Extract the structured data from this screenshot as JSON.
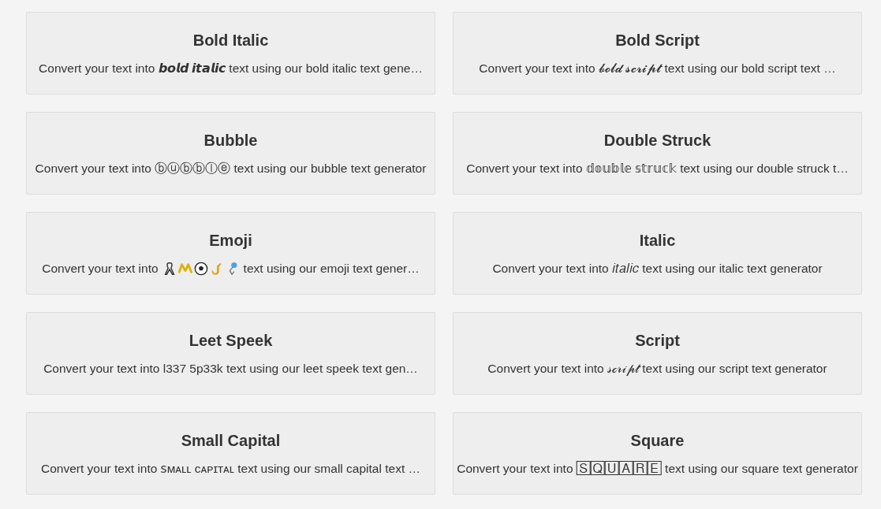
{
  "cards": [
    {
      "title": "Bold Italic",
      "kind": "text",
      "description": "Convert your text into 𝙗𝙤𝙡𝙙 𝙞𝙩𝙖𝙡𝙞𝙘 text using our bold italic text gene…"
    },
    {
      "title": "Bold Script",
      "kind": "text",
      "description": "Convert your text into 𝓫𝓸𝓵𝓭 𝓼𝓬𝓻𝓲𝓹𝓽 text using our bold script text …"
    },
    {
      "title": "Bubble",
      "kind": "text",
      "description": "Convert your text into ⓑⓤⓑⓑⓛⓔ text using our bubble text generator"
    },
    {
      "title": "Double Struck",
      "kind": "text",
      "description": "Convert your text into 𝕕𝕠𝕦𝕓𝕝𝕖 𝕤𝕥𝕣𝕦𝕔𝕜 text using our double struck t…"
    },
    {
      "title": "Emoji",
      "kind": "emoji",
      "description_start": "Convert your text into",
      "description_end": "text using our emoji text gener…"
    },
    {
      "title": "Italic",
      "kind": "text",
      "description": "Convert your text into 𝑖𝑡𝑎𝑙𝑖𝑐 text using our italic text generator"
    },
    {
      "title": "Leet Speek",
      "kind": "text",
      "description": "Convert your text into l337 5p33k text using our leet speek text gen…"
    },
    {
      "title": "Script",
      "kind": "text",
      "description": "Convert your text into 𝓈𝒸𝓇𝒾𝓅𝓉 text using our script text generator"
    },
    {
      "title": "Small Capital",
      "kind": "text",
      "description": "Convert your text into ꜱᴍᴀʟʟ ᴄᴀᴘɪᴛᴀʟ text using our small capital text …"
    },
    {
      "title": "Square",
      "kind": "text",
      "description": "Convert your text into 🅂🅀🅄🄰🅁🄴 text using our square text generator"
    }
  ]
}
